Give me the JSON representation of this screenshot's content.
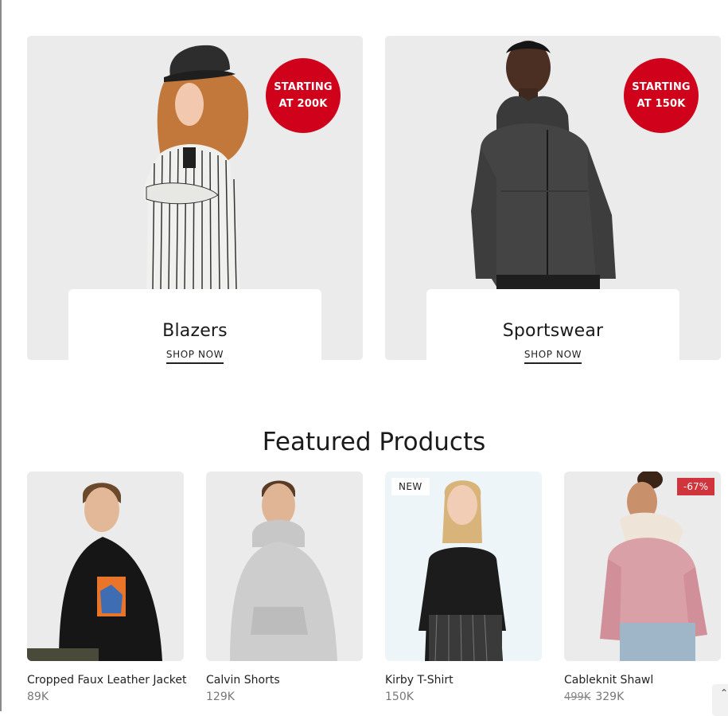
{
  "categories": [
    {
      "name": "Blazers",
      "badge_line1": "STARTING",
      "badge_line2": "AT 200K",
      "cta": "SHOP NOW"
    },
    {
      "name": "Sportswear",
      "badge_line1": "STARTING",
      "badge_line2": "AT 150K",
      "cta": "SHOP NOW"
    }
  ],
  "featured": {
    "title": "Featured Products",
    "products": [
      {
        "name": "Cropped Faux Leather Jacket",
        "price": "89K"
      },
      {
        "name": "Calvin Shorts",
        "price": "129K"
      },
      {
        "name": "Kirby T-Shirt",
        "price": "150K",
        "tag": "NEW"
      },
      {
        "name": "Cableknit Shawl",
        "old_price": "499K",
        "price": "329K",
        "tag": "-67%"
      }
    ]
  },
  "colors": {
    "accent": "#d0021b",
    "sale_tag": "#d0343c",
    "banner_bg": "#ebebeb"
  },
  "icons": {
    "scroll_top": "chevron-up-icon"
  }
}
